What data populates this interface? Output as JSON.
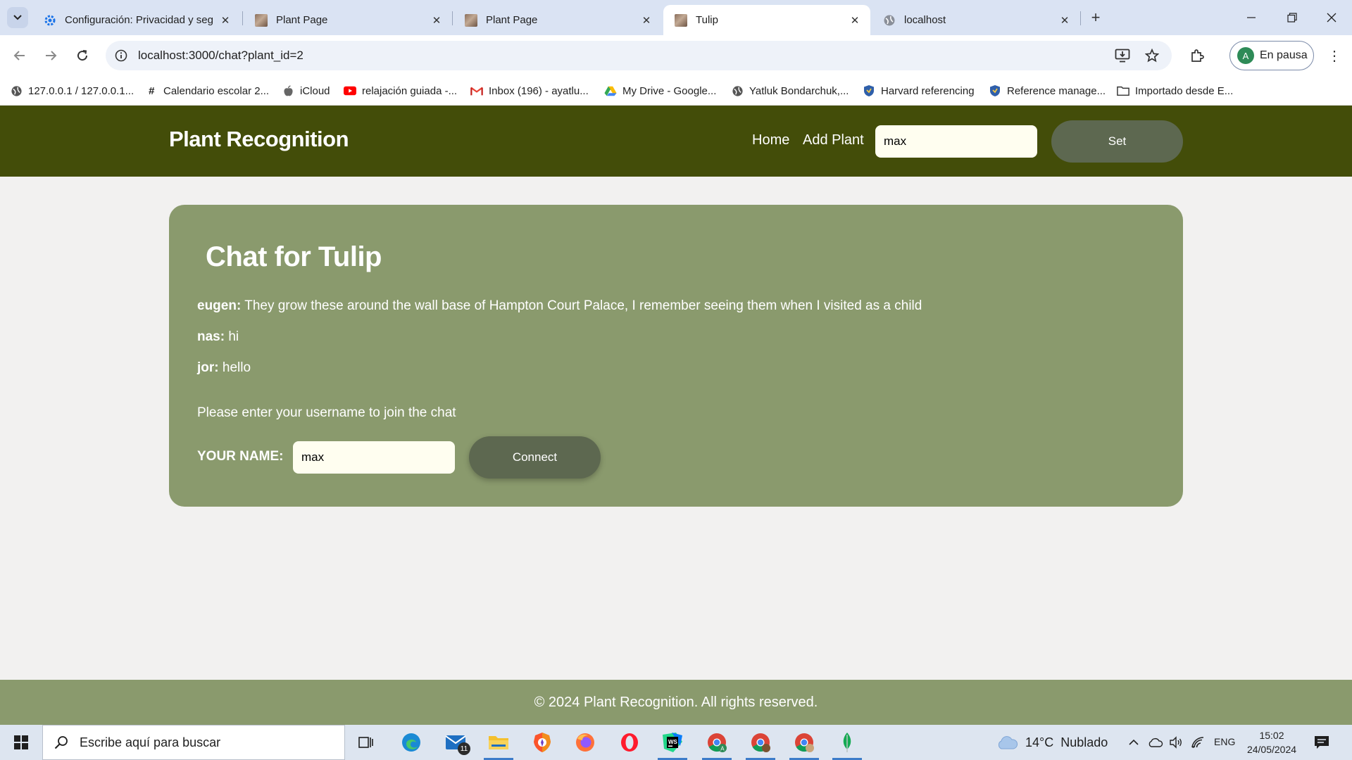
{
  "browser": {
    "tabs": [
      {
        "title": "Configuración: Privacidad y seg",
        "favicon": "gear-icon"
      },
      {
        "title": "Plant Page",
        "favicon": "plant-image-icon"
      },
      {
        "title": "Plant Page",
        "favicon": "plant-image-icon"
      },
      {
        "title": "Tulip",
        "favicon": "plant-image-icon",
        "active": true
      },
      {
        "title": "localhost",
        "favicon": "globe-icon"
      }
    ],
    "url": "localhost:3000/chat?plant_id=2",
    "profile_label": "En pausa",
    "profile_initial": "A",
    "bookmarks": [
      {
        "label": "127.0.0.1 / 127.0.0.1...",
        "icon": "globe-icon"
      },
      {
        "label": "Calendario escolar 2...",
        "icon": "hash-icon"
      },
      {
        "label": "iCloud",
        "icon": "apple-icon"
      },
      {
        "label": "relajación guiada -...",
        "icon": "youtube-icon"
      },
      {
        "label": "Inbox (196) - ayatlu...",
        "icon": "gmail-icon"
      },
      {
        "label": "My Drive - Google...",
        "icon": "drive-icon"
      },
      {
        "label": "Yatluk Bondarchuk,...",
        "icon": "globe-icon"
      },
      {
        "label": "Harvard referencing",
        "icon": "shield-icon"
      },
      {
        "label": "Reference manage...",
        "icon": "shield-icon"
      },
      {
        "label": "Importado desde E...",
        "icon": "folder-icon"
      }
    ]
  },
  "site": {
    "brand": "Plant Recognition",
    "nav": {
      "home": "Home",
      "add_plant": "Add Plant"
    },
    "username_value": "max",
    "set_label": "Set",
    "colors": {
      "header": "#434d09",
      "card": "#8a9a6d",
      "button": "#5d6850"
    }
  },
  "chat": {
    "title": "Chat for Tulip",
    "messages": [
      {
        "user": "eugen:",
        "text": "They grow these around the wall base of Hampton Court Palace, I remember seeing them when I visited as a child"
      },
      {
        "user": "nas:",
        "text": "hi"
      },
      {
        "user": "jor:",
        "text": "hello"
      }
    ],
    "join_prompt": "Please enter your username to join the chat",
    "name_label": "YOUR NAME:",
    "name_value": "max",
    "connect_label": "Connect"
  },
  "footer": {
    "text": "© 2024 Plant Recognition. All rights reserved."
  },
  "taskbar": {
    "search_placeholder": "Escribe aquí para buscar",
    "mail_badge": "11",
    "weather": "14°C  Nublado",
    "lang": "ENG",
    "time": "15:02",
    "date": "24/05/2024"
  }
}
